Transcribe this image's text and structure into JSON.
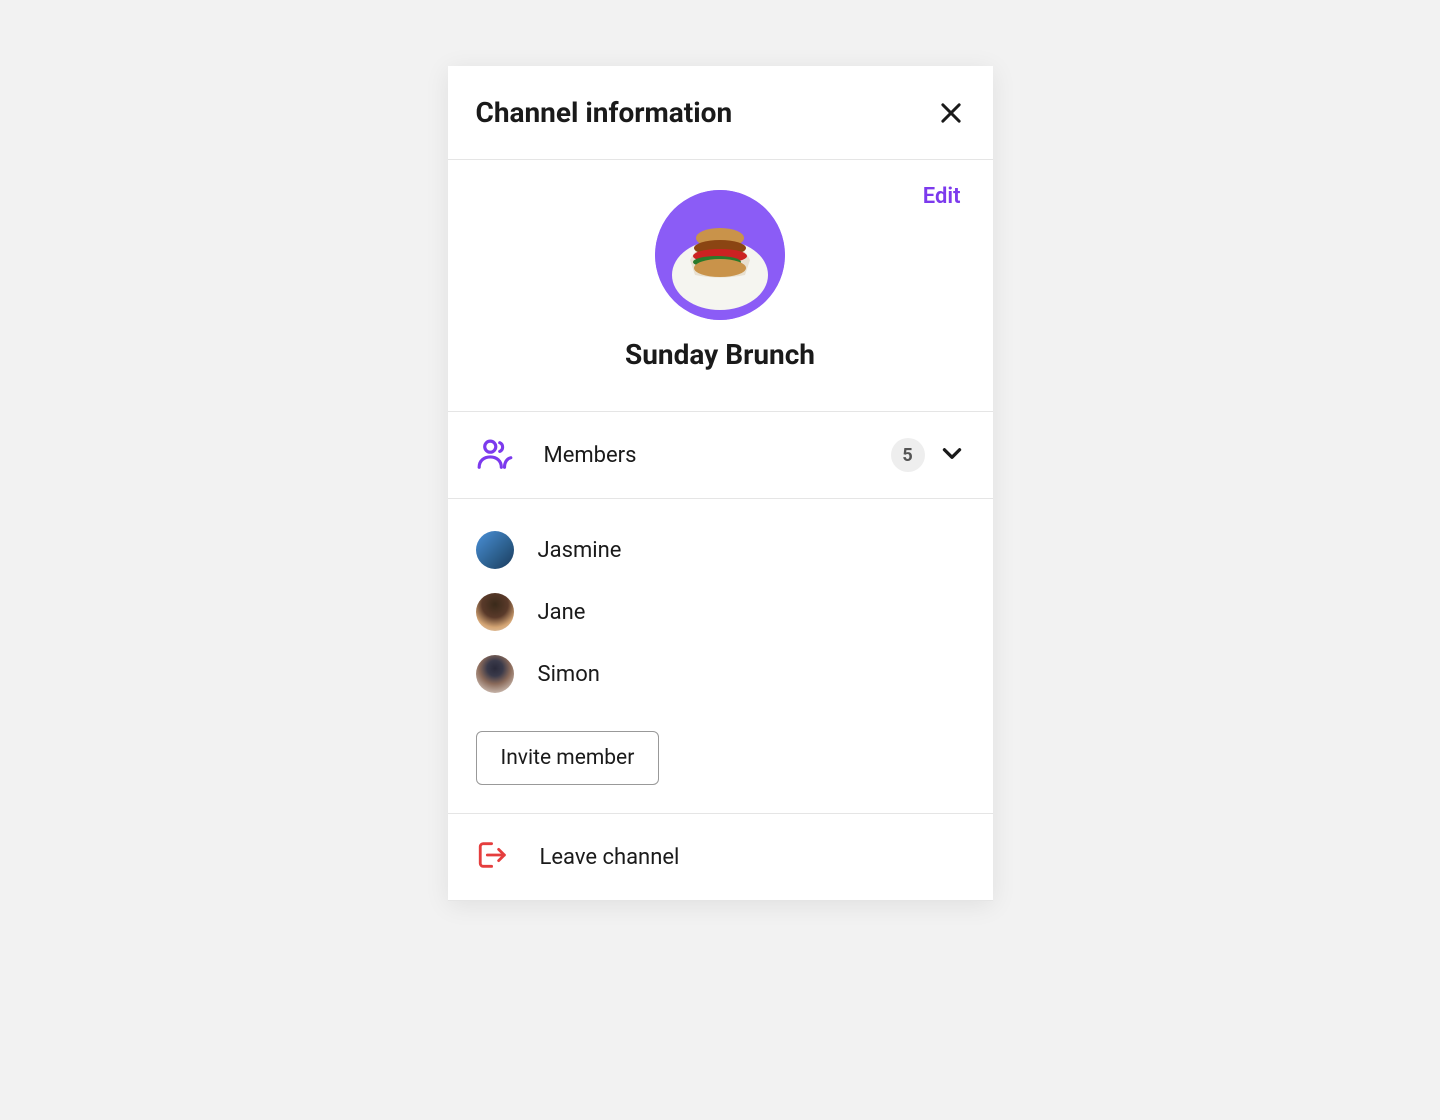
{
  "header": {
    "title": "Channel information"
  },
  "info": {
    "edit_label": "Edit",
    "channel_name": "Sunday Brunch"
  },
  "members": {
    "label": "Members",
    "count": "5",
    "items": [
      {
        "name": "Jasmine"
      },
      {
        "name": "Jane"
      },
      {
        "name": "Simon"
      }
    ]
  },
  "actions": {
    "invite_label": "Invite member",
    "leave_label": "Leave channel"
  },
  "colors": {
    "accent": "#7c3aed",
    "danger": "#e53e3e"
  }
}
